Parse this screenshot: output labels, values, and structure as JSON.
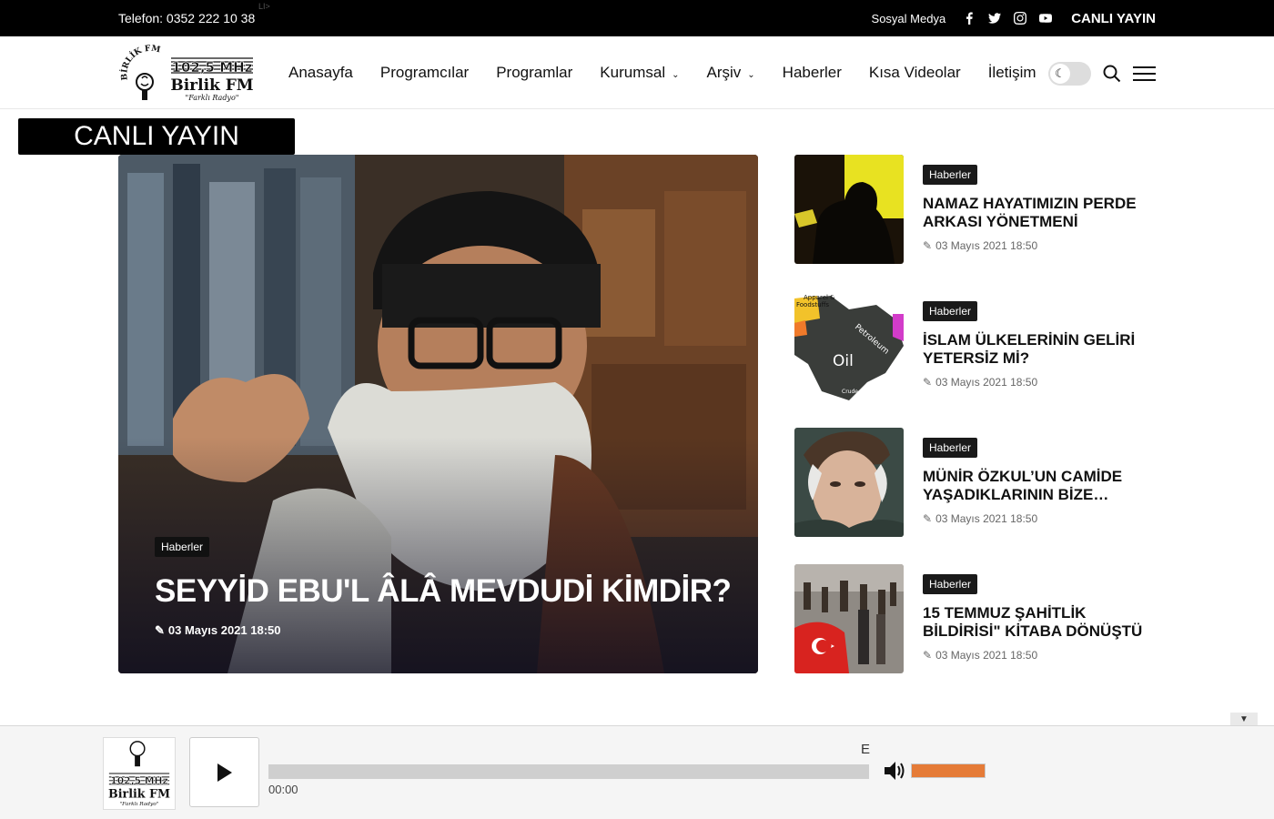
{
  "topbar": {
    "phone": "Telefon: 0352 222 10 38",
    "stray_mark": "LI>",
    "social_label": "Sosyal Medya",
    "social_icons": [
      "facebook-icon",
      "twitter-icon",
      "instagram-icon",
      "youtube-icon"
    ],
    "live_label": "CANLI YAYIN"
  },
  "brand": {
    "arc_text": "BİRLİK FM",
    "frequency": "102,5 MHz",
    "name": "Birlik FM",
    "tagline": "\"Farklı Radyo\""
  },
  "nav": {
    "items": [
      {
        "label": "Anasayfa",
        "dropdown": false
      },
      {
        "label": "Programcılar",
        "dropdown": false
      },
      {
        "label": "Programlar",
        "dropdown": false
      },
      {
        "label": "Kurumsal",
        "dropdown": true
      },
      {
        "label": "Arşiv",
        "dropdown": true
      },
      {
        "label": "Haberler",
        "dropdown": false
      },
      {
        "label": "Kısa Videolar",
        "dropdown": false
      },
      {
        "label": "İletişim",
        "dropdown": false
      }
    ],
    "dark_mode_on": false,
    "chevron_glyph": "⌄"
  },
  "live_banner": "CANLI YAYIN",
  "hero": {
    "category": "Haberler",
    "title": "SEYYİD EBU'L ÂLÂ MEVDUDİ KİMDİR?",
    "date": "03 Mayıs 2021 18:50"
  },
  "side_news": [
    {
      "category": "Haberler",
      "title": "NAMAZ HAYATIMIZIN PERDE ARKASI YÖNETMENİ",
      "date": "03 Mayıs 2021 18:50"
    },
    {
      "category": "Haberler",
      "title": "İSLAM ÜLKELERİNİN GELİRİ YETERSİZ Mİ?",
      "date": "03 Mayıs 2021 18:50"
    },
    {
      "category": "Haberler",
      "title": "MÜNİR ÖZKUL’UN CAMİDE YAŞADIKLARININ BİZE…",
      "date": "03 Mayıs 2021 18:50"
    },
    {
      "category": "Haberler",
      "title": "15 TEMMUZ ŞAHİTLİK BİLDİRİSİ\" KİTABA DÖNÜŞTÜ",
      "date": "03 Mayıs 2021 18:50"
    }
  ],
  "map_labels": {
    "oil": "Oil",
    "petroleum": "Petroleum",
    "crude_oil": "Crude Oil",
    "apparel": "Apparel &",
    "foodstuffs": "Foodstuffs"
  },
  "player": {
    "time": "00:00",
    "station_letter": "E",
    "progress": 0,
    "volume": 1.0
  },
  "colors": {
    "topbar_bg": "#000000",
    "badge_bg": "#1a1a1a",
    "volume_fill": "#e57b37"
  }
}
